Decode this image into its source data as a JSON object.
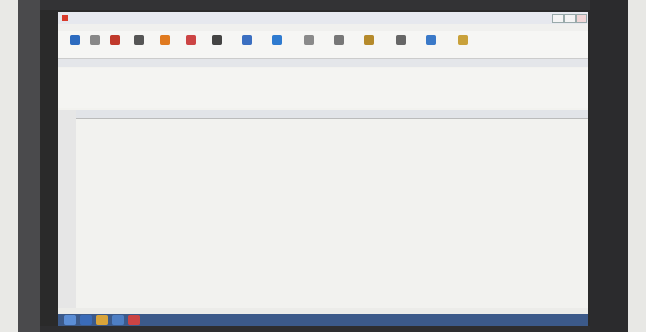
{
  "app": {
    "name": "",
    "window_title": ""
  },
  "menu": [],
  "toolbar": [
    {
      "label": "",
      "icon": "gear-icon",
      "color": "#2d6bbf"
    },
    {
      "label": "",
      "icon": "gear-icon",
      "color": "#888888"
    },
    {
      "label": "",
      "icon": "shield-icon",
      "color": "#c0392b"
    },
    {
      "label": "",
      "icon": "user-icon",
      "color": "#555555"
    },
    {
      "label": "",
      "icon": "folder-icon",
      "color": "#e07a1f"
    },
    {
      "label": "",
      "icon": "cart-icon",
      "color": "#c44"
    },
    {
      "label": "",
      "icon": "person-icon",
      "color": "#444444"
    },
    {
      "label": "",
      "icon": "chart-icon",
      "color": "#3b6fc1"
    },
    {
      "label": "",
      "icon": "table-icon",
      "color": "#2f7bd0"
    },
    {
      "label": "",
      "icon": "document-icon",
      "color": "#8a8a8a"
    },
    {
      "label": "",
      "icon": "person-icon",
      "color": "#777777"
    },
    {
      "label": "",
      "icon": "box-icon",
      "color": "#b58a2b"
    },
    {
      "label": "",
      "icon": "user-icon",
      "color": "#666666"
    },
    {
      "label": "",
      "icon": "flag-icon",
      "color": "#3a79c8"
    },
    {
      "label": "",
      "icon": "note-icon",
      "color": "#c9a13a"
    }
  ],
  "tabs": [],
  "subtoolbar": [],
  "filter_label": "",
  "grid": {
    "columns": [],
    "rows": []
  },
  "status_bar": [],
  "colors": {
    "highlight_red": "#e32414",
    "selected_purple": "#5b39d6",
    "selected_blue": "#a8d4ef",
    "row_orange": "#f9ddc0",
    "row_light": "#f5f1ec",
    "row_pink": "#f3c4c0"
  }
}
